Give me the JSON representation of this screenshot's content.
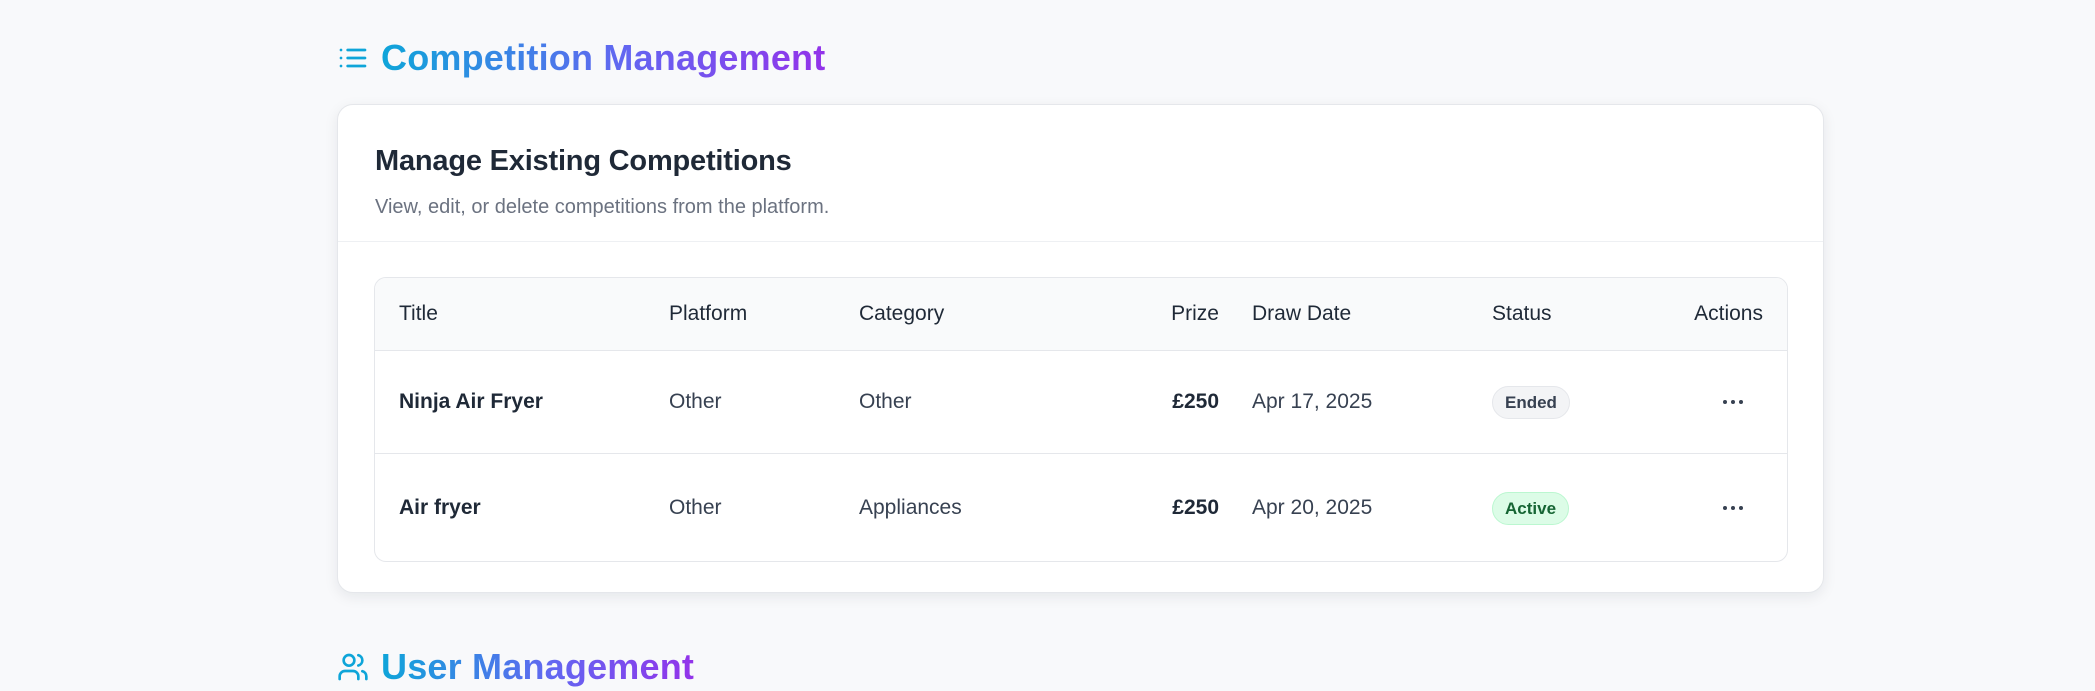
{
  "sections": {
    "competition": {
      "title": "Competition Management",
      "icon": "list-icon"
    },
    "users": {
      "title": "User Management",
      "icon": "users-icon"
    }
  },
  "card": {
    "title": "Manage Existing Competitions",
    "description": "View, edit, or delete competitions from the platform."
  },
  "table": {
    "headers": {
      "title": "Title",
      "platform": "Platform",
      "category": "Category",
      "prize": "Prize",
      "draw_date": "Draw Date",
      "status": "Status",
      "actions": "Actions"
    },
    "rows": [
      {
        "title": "Ninja Air Fryer",
        "platform": "Other",
        "category": "Other",
        "prize": "£250",
        "draw_date": "Apr 17, 2025",
        "status": "Ended",
        "actions_icon": "more-horizontal-icon"
      },
      {
        "title": "Air fryer",
        "platform": "Other",
        "category": "Appliances",
        "prize": "£250",
        "draw_date": "Apr 20, 2025",
        "status": "Active",
        "actions_icon": "more-horizontal-icon"
      }
    ]
  },
  "colors": {
    "gradient_start": "#0ea5d9",
    "gradient_mid": "#6366f1",
    "gradient_end": "#9333ea",
    "status_active_bg": "#dcfce7",
    "status_ended_bg": "#f3f4f6"
  }
}
